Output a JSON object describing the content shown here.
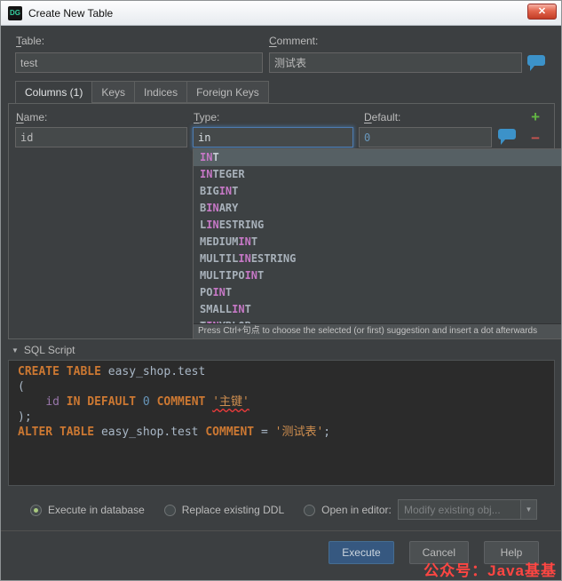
{
  "window": {
    "title": "Create New Table",
    "app_icon": "DG",
    "close_glyph": "✕"
  },
  "form": {
    "table_label": {
      "mnemonic": "T",
      "rest": "able:"
    },
    "table_value": "test",
    "comment_label": {
      "mnemonic": "C",
      "rest": "omment:"
    },
    "comment_value": "测试表"
  },
  "tabs": [
    {
      "label": "Columns (1)",
      "selected": true
    },
    {
      "label": "Keys",
      "selected": false
    },
    {
      "label": "Indices",
      "selected": false
    },
    {
      "label": "Foreign Keys",
      "selected": false
    }
  ],
  "columns_tab": {
    "name_label": {
      "mnemonic": "N",
      "rest": "ame:"
    },
    "name_value": "id",
    "type_label": {
      "mnemonic": "T",
      "rest": "ype:"
    },
    "type_value": "in",
    "default_label": {
      "mnemonic": "D",
      "rest": "efault:"
    },
    "default_value": "0",
    "add_glyph": "+",
    "remove_glyph": "−"
  },
  "autocomplete": {
    "selected_index": 0,
    "items": [
      {
        "pre": "",
        "match": "IN",
        "post": "T"
      },
      {
        "pre": "",
        "match": "IN",
        "post": "TEGER"
      },
      {
        "pre": "BIG",
        "match": "IN",
        "post": "T"
      },
      {
        "pre": "B",
        "match": "IN",
        "post": "ARY"
      },
      {
        "pre": "L",
        "match": "IN",
        "post": "ESTRING"
      },
      {
        "pre": "MEDIUM",
        "match": "IN",
        "post": "T"
      },
      {
        "pre": "MULTIL",
        "match": "IN",
        "post": "ESTRING"
      },
      {
        "pre": "MULTIPO",
        "match": "IN",
        "post": "T"
      },
      {
        "pre": "PO",
        "match": "IN",
        "post": "T"
      },
      {
        "pre": "SMALL",
        "match": "IN",
        "post": "T"
      },
      {
        "pre": "T",
        "match": "IN",
        "post": "YBLOB"
      }
    ],
    "hint": "Press Ctrl+句点 to choose the selected (or first) suggestion and insert a dot afterwards"
  },
  "sql_script": {
    "collapse_glyph": "▼",
    "title": "SQL Script",
    "lines": [
      [
        {
          "type": "kw",
          "text": "CREATE "
        },
        {
          "type": "kw",
          "text": "TABLE "
        },
        {
          "type": "plain",
          "text": "easy_shop.test"
        }
      ],
      [
        {
          "type": "plain",
          "text": "("
        }
      ],
      [
        {
          "type": "plain",
          "text": "    "
        },
        {
          "type": "ident",
          "text": "id "
        },
        {
          "type": "kw",
          "text": "IN "
        },
        {
          "type": "kw",
          "text": "DEFAULT "
        },
        {
          "type": "num",
          "text": "0 "
        },
        {
          "type": "kw",
          "text": "COMMENT "
        },
        {
          "type": "str",
          "text": "'主键'",
          "error": true
        }
      ],
      [
        {
          "type": "plain",
          "text": ");"
        }
      ],
      [
        {
          "type": "kw",
          "text": "ALTER "
        },
        {
          "type": "kw",
          "text": "TABLE "
        },
        {
          "type": "plain",
          "text": "easy_shop.test "
        },
        {
          "type": "kw",
          "text": "COMMENT "
        },
        {
          "type": "plain",
          "text": "= "
        },
        {
          "type": "str",
          "text": "'测试表'"
        },
        {
          "type": "plain",
          "text": ";"
        }
      ]
    ]
  },
  "options": {
    "radios": [
      {
        "label": "Execute in database",
        "selected": true
      },
      {
        "label": "Replace existing DDL",
        "selected": false
      },
      {
        "label": "Open in editor:",
        "selected": false
      }
    ],
    "editor_combo_value": "Modify existing obj...",
    "combo_arrow_glyph": "▼"
  },
  "footer": {
    "execute": "Execute",
    "cancel": "Cancel",
    "help": "Help"
  },
  "watermark": "公众号：Java基基",
  "colors": {
    "dialog_bg": "#3c3f41",
    "editor_bg": "#2b2b2b",
    "focus_border": "#4e7bb0",
    "execute_button": "#365880",
    "add_green": "#62b543",
    "remove_red": "#c75450",
    "keyword": "#cc7832",
    "number": "#6897bb",
    "string": "#ce8e4f",
    "match_highlight": "#c678c6",
    "error_underline": "#f23b3b",
    "watermark": "#ff4642",
    "comment_icon_blue": "#3c92c9"
  }
}
